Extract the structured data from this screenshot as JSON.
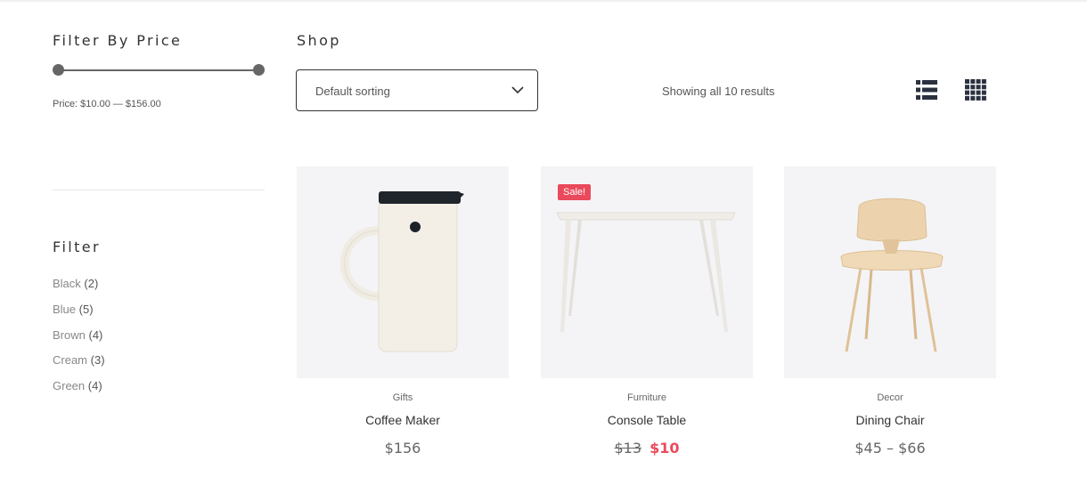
{
  "sidebar": {
    "price_filter": {
      "title": "Filter By Price",
      "range_text": "Price: $10.00 — $156.00",
      "min_value": 10,
      "max_value": 156
    },
    "color_filter": {
      "title": "Filter",
      "items": [
        {
          "label": "Black",
          "count": "(2)"
        },
        {
          "label": "Blue",
          "count": "(5)"
        },
        {
          "label": "Brown",
          "count": "(4)"
        },
        {
          "label": "Cream",
          "count": "(3)"
        },
        {
          "label": "Green",
          "count": "(4)"
        }
      ]
    }
  },
  "shop": {
    "title": "Shop",
    "sort": {
      "selected": "Default sorting"
    },
    "result_count": "Showing all 10 results",
    "view_modes": [
      "list-view-icon",
      "grid-view-icon"
    ]
  },
  "products": [
    {
      "category": "Gifts",
      "name": "Coffee Maker",
      "price": "$156"
    },
    {
      "category": "Furniture",
      "name": "Console Table",
      "badge": "Sale!",
      "old_price": "$13",
      "sale_price": "$10"
    },
    {
      "category": "Decor",
      "name": "Dining Chair",
      "price": "$45 – $66"
    }
  ],
  "colors": {
    "sale": "#ea4a5c",
    "image_bg": "#f4f4f6",
    "text": "#333333"
  }
}
